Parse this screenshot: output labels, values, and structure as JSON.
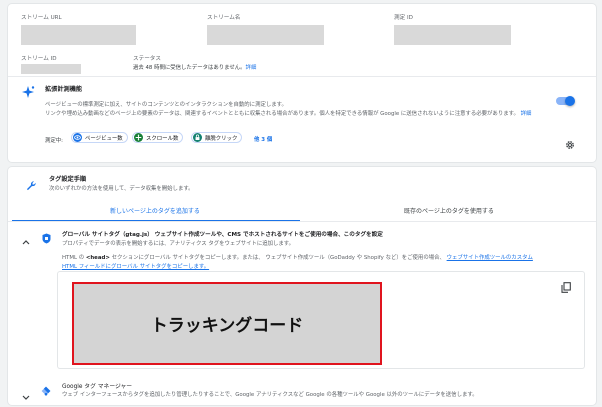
{
  "stream_details": {
    "stream_url_label": "ストリーム URL",
    "stream_name_label": "ストリーム名",
    "measurement_id_label": "測定 ID",
    "stream_id_label": "ストリーム ID",
    "status_label": "ステータス",
    "status_text": "過去 48 時間に受信したデータはありません。",
    "status_link": "詳細"
  },
  "enhanced_measurement": {
    "title": "拡張計測機能",
    "desc_line1": "ページビューの標準測定に加え、サイトのコンテンツとのインタラクションを自動的に測定します。",
    "desc_line2": "リンクや埋め込み動画などのページ上の要素のデータは、関連するイベントとともに収集される場合があります。個人を特定できる情報が Google に送信されないように注意する必要があります。",
    "desc_link": "詳細",
    "enabled": true,
    "measuring_label": "測定中:",
    "chips": [
      {
        "label": "ページビュー数",
        "icon": "eye-icon",
        "color": "#1a73e8"
      },
      {
        "label": "スクロール数",
        "icon": "crosshair-icon",
        "color": "#188038"
      },
      {
        "label": "離脱クリック",
        "icon": "lock-icon",
        "color": "#12806f"
      }
    ],
    "more_label": "他 3 個"
  },
  "tag_setup": {
    "title": "タグ設定手順",
    "subtitle": "次のいずれかの方法を使用して、データ収集を開始します。",
    "tabs": [
      {
        "label": "新しいページ上のタグを追加する",
        "active": true
      },
      {
        "label": "既存のページ上のタグを使用する",
        "active": false
      }
    ],
    "gtag": {
      "title": "グローバル サイトタグ（gtag.js） ウェブサイト作成ツールや、CMS でホストされるサイトをご使用の場合、このタグを設定",
      "subtitle": "プロパティでデータの表示を開始するには、アナリティクス タグをウェブサイトに追加します。",
      "instr_pre": "HTML の",
      "instr_head": "<head>",
      "instr_post": "セクションにグローバル サイトタグをコピーします。または、 ウェブサイト作成ツール（GoDaddy や Shopify など）をご使用の場合、",
      "instr_link1": "ウェブサイト作成ツールのカスタム",
      "instr_link2": "HTML フィールドにグローバル サイトタグをコピーします。",
      "code_overlay": "トラッキングコード"
    },
    "gtm": {
      "title": "Google タグ マネージャー",
      "subtitle": "ウェブ インターフェースからタグを追加したり管理したりすることで、Google アナリティクスなど Google の各種ツールや Google 以外のツールにデータを送信します。"
    }
  },
  "colors": {
    "accent": "#1a73e8",
    "highlight_border": "#e0141e"
  }
}
